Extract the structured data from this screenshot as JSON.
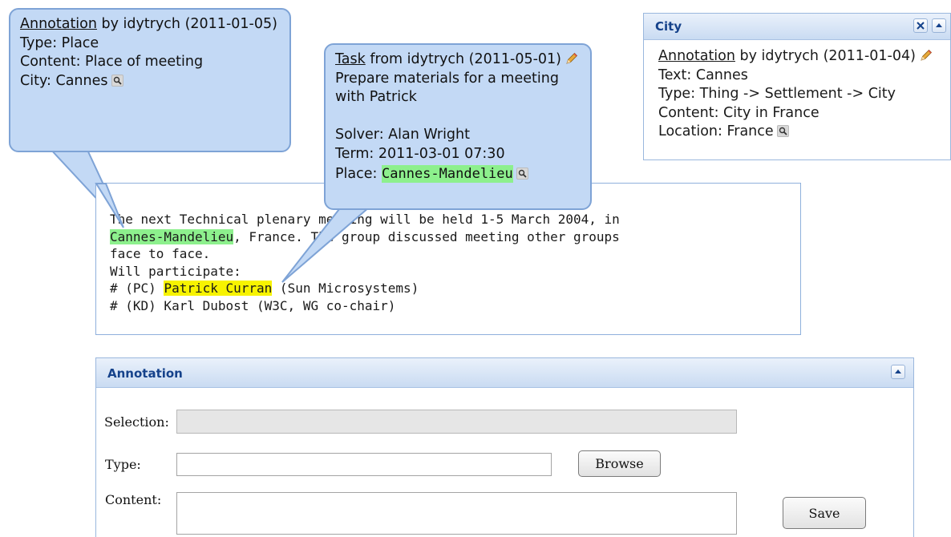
{
  "bubble_annotation": {
    "link": "Annotation",
    "by": " by idytrych (2011-01-05)",
    "type": "Type: Place",
    "content": "Content: Place of meeting",
    "city": "City: Cannes"
  },
  "bubble_task": {
    "link": "Task",
    "by": " from idytrych (2011-05-01)",
    "desc_line1": "Prepare materials for a meeting",
    "desc_line2": "with Patrick",
    "solver": "Solver: Alan Wright",
    "term": "Term: 2011-03-01 07:30",
    "place_label": "Place: ",
    "place_value": "Cannes-Mandelieu"
  },
  "city_panel": {
    "title": "City",
    "link": "Annotation",
    "by": " by idytrych (2011-01-04)",
    "text": "Text: Cannes",
    "type": "Type: Thing -> Settlement -> City",
    "content": "Content: City in France",
    "location": "Location: France"
  },
  "document": {
    "l1": "The next Technical plenary meeting will be held 1-5 March 2004, in",
    "l2_hl": "Cannes-Mandelieu",
    "l2_rest": ", France. The group discussed meeting other groups",
    "l3": "face to face.",
    "l4": "Will participate:",
    "l5_pre": "# (PC) ",
    "l5_hl": "Patrick Curran",
    "l5_post": " (Sun Microsystems)",
    "l6": "# (KD) Karl Dubost (W3C, WG co-chair)"
  },
  "annotation_panel": {
    "title": "Annotation",
    "selection_label": "Selection:",
    "selection_value": "",
    "type_label": "Type:",
    "type_value": "",
    "browse_label": "Browse",
    "content_label": "Content:",
    "content_value": "",
    "save_label": "Save"
  },
  "icons": {
    "search": "search-icon",
    "edit": "edit-pencil-icon",
    "close": "close-icon",
    "collapse": "collapse-icon"
  },
  "colors": {
    "bubble_bg": "#c3d9f5",
    "bubble_border": "#7ea3d6",
    "highlight_place": "#8df08d",
    "highlight_person": "#f7f300",
    "panel_title": "#15428b"
  }
}
